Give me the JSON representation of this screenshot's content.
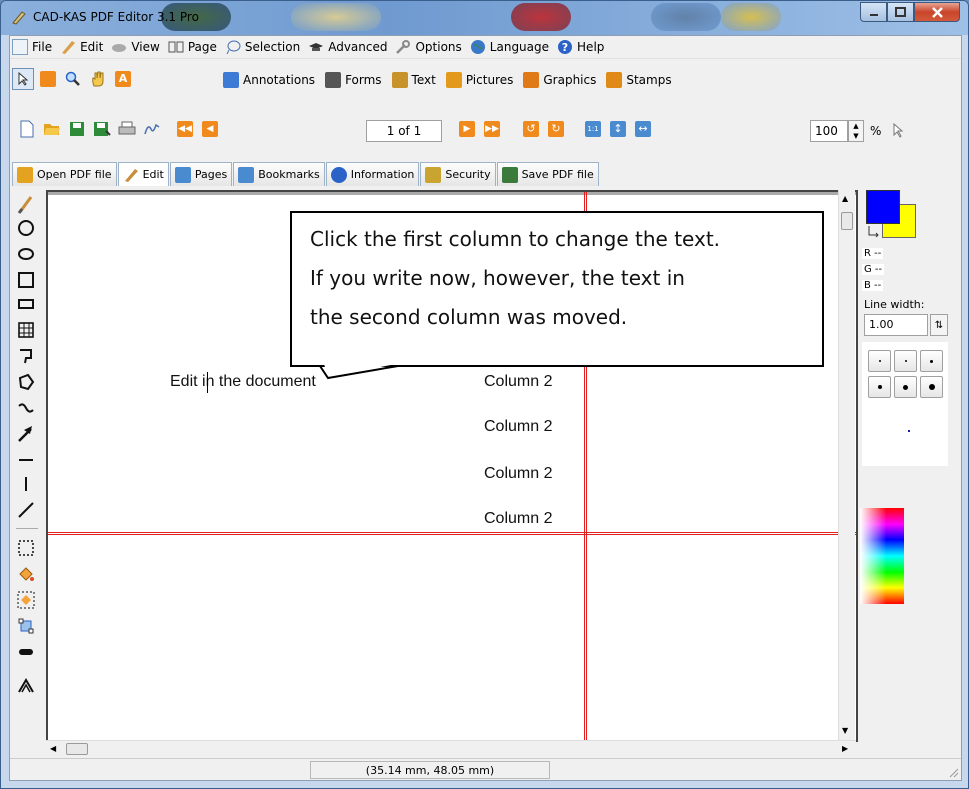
{
  "window": {
    "title": "CAD-KAS PDF Editor 3.1 Pro"
  },
  "menu": [
    {
      "label": "File",
      "icon": "file-icon",
      "color": "#7f9fbf"
    },
    {
      "label": "Edit",
      "icon": "pen-icon",
      "color": "#d9a04a"
    },
    {
      "label": "View",
      "icon": "view-icon",
      "color": "#7a7a7a"
    },
    {
      "label": "Page",
      "icon": "book-icon",
      "color": "#555555"
    },
    {
      "label": "Selection",
      "icon": "lasso-icon",
      "color": "#4a6fb0"
    },
    {
      "label": "Advanced",
      "icon": "hat-icon",
      "color": "#333333"
    },
    {
      "label": "Options",
      "icon": "wrench-icon",
      "color": "#8a8a8a"
    },
    {
      "label": "Language",
      "icon": "globe-icon",
      "color": "#3a8a3a"
    },
    {
      "label": "Help",
      "icon": "help-icon",
      "color": "#2a62c8"
    }
  ],
  "modules": [
    {
      "label": "Annotations",
      "icon": "annotation-icon",
      "color": "#3d7bd4"
    },
    {
      "label": "Forms",
      "icon": "forms-icon",
      "color": "#555555"
    },
    {
      "label": "Text",
      "icon": "text-tool-icon",
      "color": "#c8932a"
    },
    {
      "label": "Pictures",
      "icon": "pictures-icon",
      "color": "#e39a1c"
    },
    {
      "label": "Graphics",
      "icon": "graphics-icon",
      "color": "#e07a16"
    },
    {
      "label": "Stamps",
      "icon": "stamps-icon",
      "color": "#e08a18"
    }
  ],
  "navigation": {
    "page_display": "1 of 1"
  },
  "zoom": {
    "value": "100",
    "unit": "%"
  },
  "tabs": [
    {
      "label": "Open PDF file",
      "icon": "open-folder-icon",
      "color": "#e3a21f"
    },
    {
      "label": "Edit",
      "icon": "pen-icon",
      "color": "#c98d3a"
    },
    {
      "label": "Pages",
      "icon": "pages-icon",
      "color": "#4a8bd0"
    },
    {
      "label": "Bookmarks",
      "icon": "bookmark-icon",
      "color": "#4a8bd0"
    },
    {
      "label": "Information",
      "icon": "info-icon",
      "color": "#2a62c8"
    },
    {
      "label": "Security",
      "icon": "key-icon",
      "color": "#c9a430"
    },
    {
      "label": "Save PDF file",
      "icon": "save-icon",
      "color": "#3a7a3a"
    }
  ],
  "document": {
    "callout_lines": [
      "Click the first column to change the text.",
      "If you write now, however, the text in",
      "the second column was moved."
    ],
    "col1_text": "Edit in the document",
    "col2_rows": [
      "Column 2",
      "Column 2",
      "Column 2",
      "Column 2"
    ]
  },
  "colors": {
    "primary": "#0000ff",
    "secondary": "#ffff00"
  },
  "rgb": {
    "r": "R --",
    "g": "G --",
    "b": "B --"
  },
  "line_width": {
    "label": "Line width:",
    "value": "1.00"
  },
  "status": {
    "coordinates": "(35.14 mm, 48.05 mm)"
  }
}
